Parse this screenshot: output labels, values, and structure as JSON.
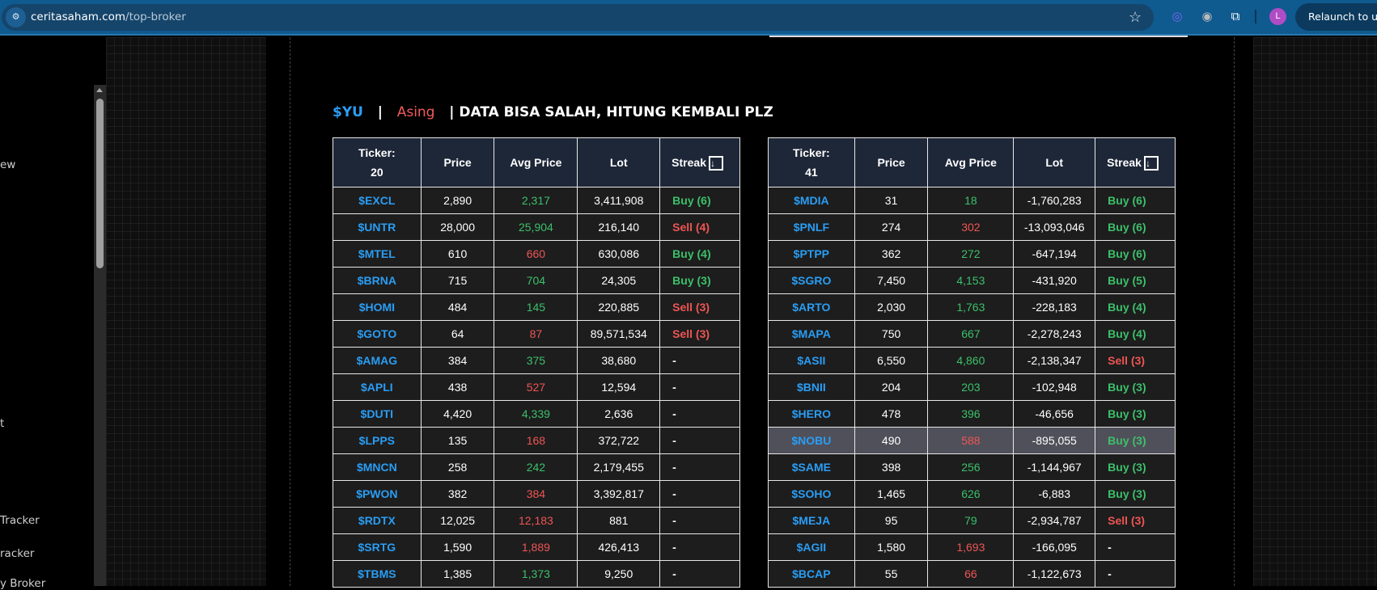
{
  "browser": {
    "url_host": "ceritasaham.com",
    "url_path": "/top-broker",
    "relaunch_label": "Relaunch to up",
    "profile_initial": "L"
  },
  "sidebar": {
    "items": [
      "ew",
      "t",
      "Tracker",
      "racker",
      "y Broker"
    ]
  },
  "header": {
    "broker": "$YU",
    "sep1": "|",
    "type": "Asing",
    "note": "| DATA BISA SALAH, HITUNG KEMBALI PLZ"
  },
  "colors": {
    "positive": "#3cc06a",
    "negative": "#ef5555",
    "ticker": "#2a9df4",
    "header_bg": "#1e2738"
  },
  "tables": [
    {
      "ticker_label": "Ticker:",
      "count": "20",
      "cols": [
        "Price",
        "Avg Price",
        "Lot",
        "Streak"
      ],
      "sort_icon": "↓",
      "rows": [
        [
          "$EXCL",
          "2,890",
          "2,317",
          "up",
          "3,411,908",
          "Buy (6)",
          "buy"
        ],
        [
          "$UNTR",
          "28,000",
          "25,904",
          "up",
          "216,140",
          "Sell (4)",
          "sell"
        ],
        [
          "$MTEL",
          "610",
          "660",
          "dn",
          "630,086",
          "Buy (4)",
          "buy"
        ],
        [
          "$BRNA",
          "715",
          "704",
          "up",
          "24,305",
          "Buy (3)",
          "buy"
        ],
        [
          "$HOMI",
          "484",
          "145",
          "up",
          "220,885",
          "Sell (3)",
          "sell"
        ],
        [
          "$GOTO",
          "64",
          "87",
          "dn",
          "89,571,534",
          "Sell (3)",
          "sell"
        ],
        [
          "$AMAG",
          "384",
          "375",
          "up",
          "38,680",
          "-",
          "none"
        ],
        [
          "$APLI",
          "438",
          "527",
          "dn",
          "12,594",
          "-",
          "none"
        ],
        [
          "$DUTI",
          "4,420",
          "4,339",
          "up",
          "2,636",
          "-",
          "none"
        ],
        [
          "$LPPS",
          "135",
          "168",
          "dn",
          "372,722",
          "-",
          "none"
        ],
        [
          "$MNCN",
          "258",
          "242",
          "up",
          "2,179,455",
          "-",
          "none"
        ],
        [
          "$PWON",
          "382",
          "384",
          "dn",
          "3,392,817",
          "-",
          "none"
        ],
        [
          "$RDTX",
          "12,025",
          "12,183",
          "dn",
          "881",
          "-",
          "none"
        ],
        [
          "$SRTG",
          "1,590",
          "1,889",
          "dn",
          "426,413",
          "-",
          "none"
        ],
        [
          "$TBMS",
          "1,385",
          "1,373",
          "up",
          "9,250",
          "-",
          "none"
        ]
      ]
    },
    {
      "ticker_label": "Ticker:",
      "count": "41",
      "cols": [
        "Price",
        "Avg Price",
        "Lot",
        "Streak"
      ],
      "sort_icon": "↓",
      "rows": [
        [
          "$MDIA",
          "31",
          "18",
          "up",
          "-1,760,283",
          "Buy (6)",
          "buy"
        ],
        [
          "$PNLF",
          "274",
          "302",
          "dn",
          "-13,093,046",
          "Buy (6)",
          "buy"
        ],
        [
          "$PTPP",
          "362",
          "272",
          "up",
          "-647,194",
          "Buy (6)",
          "buy"
        ],
        [
          "$SGRO",
          "7,450",
          "4,153",
          "up",
          "-431,920",
          "Buy (5)",
          "buy"
        ],
        [
          "$ARTO",
          "2,030",
          "1,763",
          "up",
          "-228,183",
          "Buy (4)",
          "buy"
        ],
        [
          "$MAPA",
          "750",
          "667",
          "up",
          "-2,278,243",
          "Buy (4)",
          "buy"
        ],
        [
          "$ASII",
          "6,550",
          "4,860",
          "up",
          "-2,138,347",
          "Sell (3)",
          "sell"
        ],
        [
          "$BNII",
          "204",
          "203",
          "up",
          "-102,948",
          "Buy (3)",
          "buy"
        ],
        [
          "$HERO",
          "478",
          "396",
          "up",
          "-46,656",
          "Buy (3)",
          "buy"
        ],
        [
          "$NOBU",
          "490",
          "588",
          "dn",
          "-895,055",
          "Buy (3)",
          "buy"
        ],
        [
          "$SAME",
          "398",
          "256",
          "up",
          "-1,144,967",
          "Buy (3)",
          "buy"
        ],
        [
          "$SOHO",
          "1,465",
          "626",
          "up",
          "-6,883",
          "Buy (3)",
          "buy"
        ],
        [
          "$MEJA",
          "95",
          "79",
          "up",
          "-2,934,787",
          "Sell (3)",
          "sell"
        ],
        [
          "$AGII",
          "1,580",
          "1,693",
          "dn",
          "-166,095",
          "-",
          "none"
        ],
        [
          "$BCAP",
          "55",
          "66",
          "dn",
          "-1,122,673",
          "-",
          "none"
        ]
      ],
      "highlighted_row": 9
    }
  ]
}
